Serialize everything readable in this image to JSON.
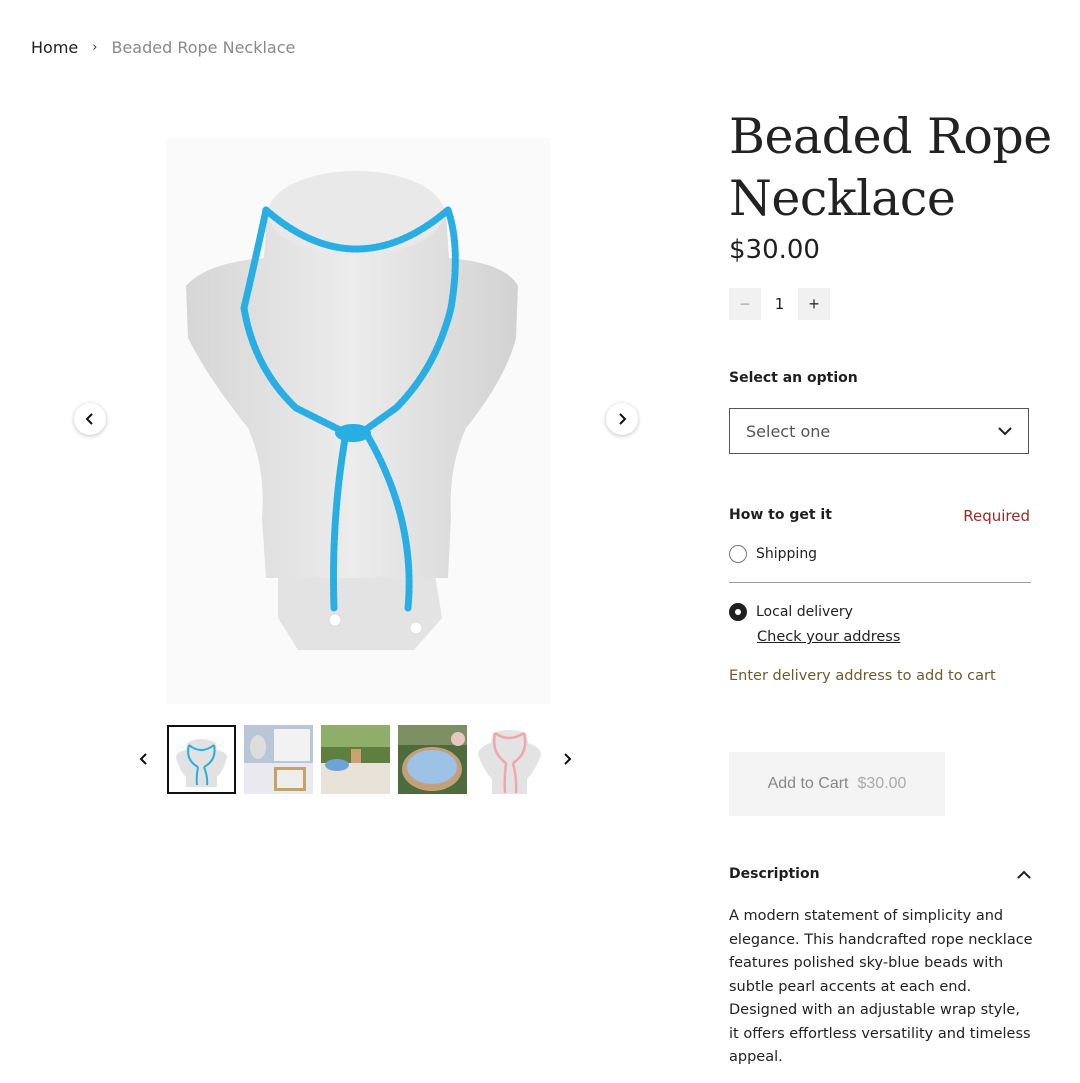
{
  "breadcrumb": {
    "home": "Home",
    "current": "Beaded Rope Necklace"
  },
  "product": {
    "title": "Beaded Rope Necklace",
    "price": "$30.00",
    "quantity": "1"
  },
  "gallery": {
    "thumbnails": [
      {
        "name": "blue-necklace-bust"
      },
      {
        "name": "market-display-table"
      },
      {
        "name": "outdoor-vendor-table"
      },
      {
        "name": "bowl-of-necklaces"
      },
      {
        "name": "pink-necklace-bust"
      }
    ]
  },
  "options": {
    "label": "Select an option",
    "selected": "Select one"
  },
  "fulfillment": {
    "label": "How to get it",
    "required": "Required",
    "shipping": "Shipping",
    "local_delivery": "Local delivery",
    "check_address": "Check your address",
    "note": "Enter delivery address to add to cart"
  },
  "cart": {
    "label": "Add to Cart",
    "price": "$30.00"
  },
  "description": {
    "title": "Description",
    "text": "A modern statement of simplicity and elegance. This handcrafted rope necklace features polished sky-blue beads with subtle pearl accents at each end. Designed with an adjustable wrap style, it offers effortless versatility and timeless appeal."
  },
  "colors": {
    "bead": "#29aee3",
    "required": "#9b2a2a",
    "note": "#6f5a2f"
  }
}
